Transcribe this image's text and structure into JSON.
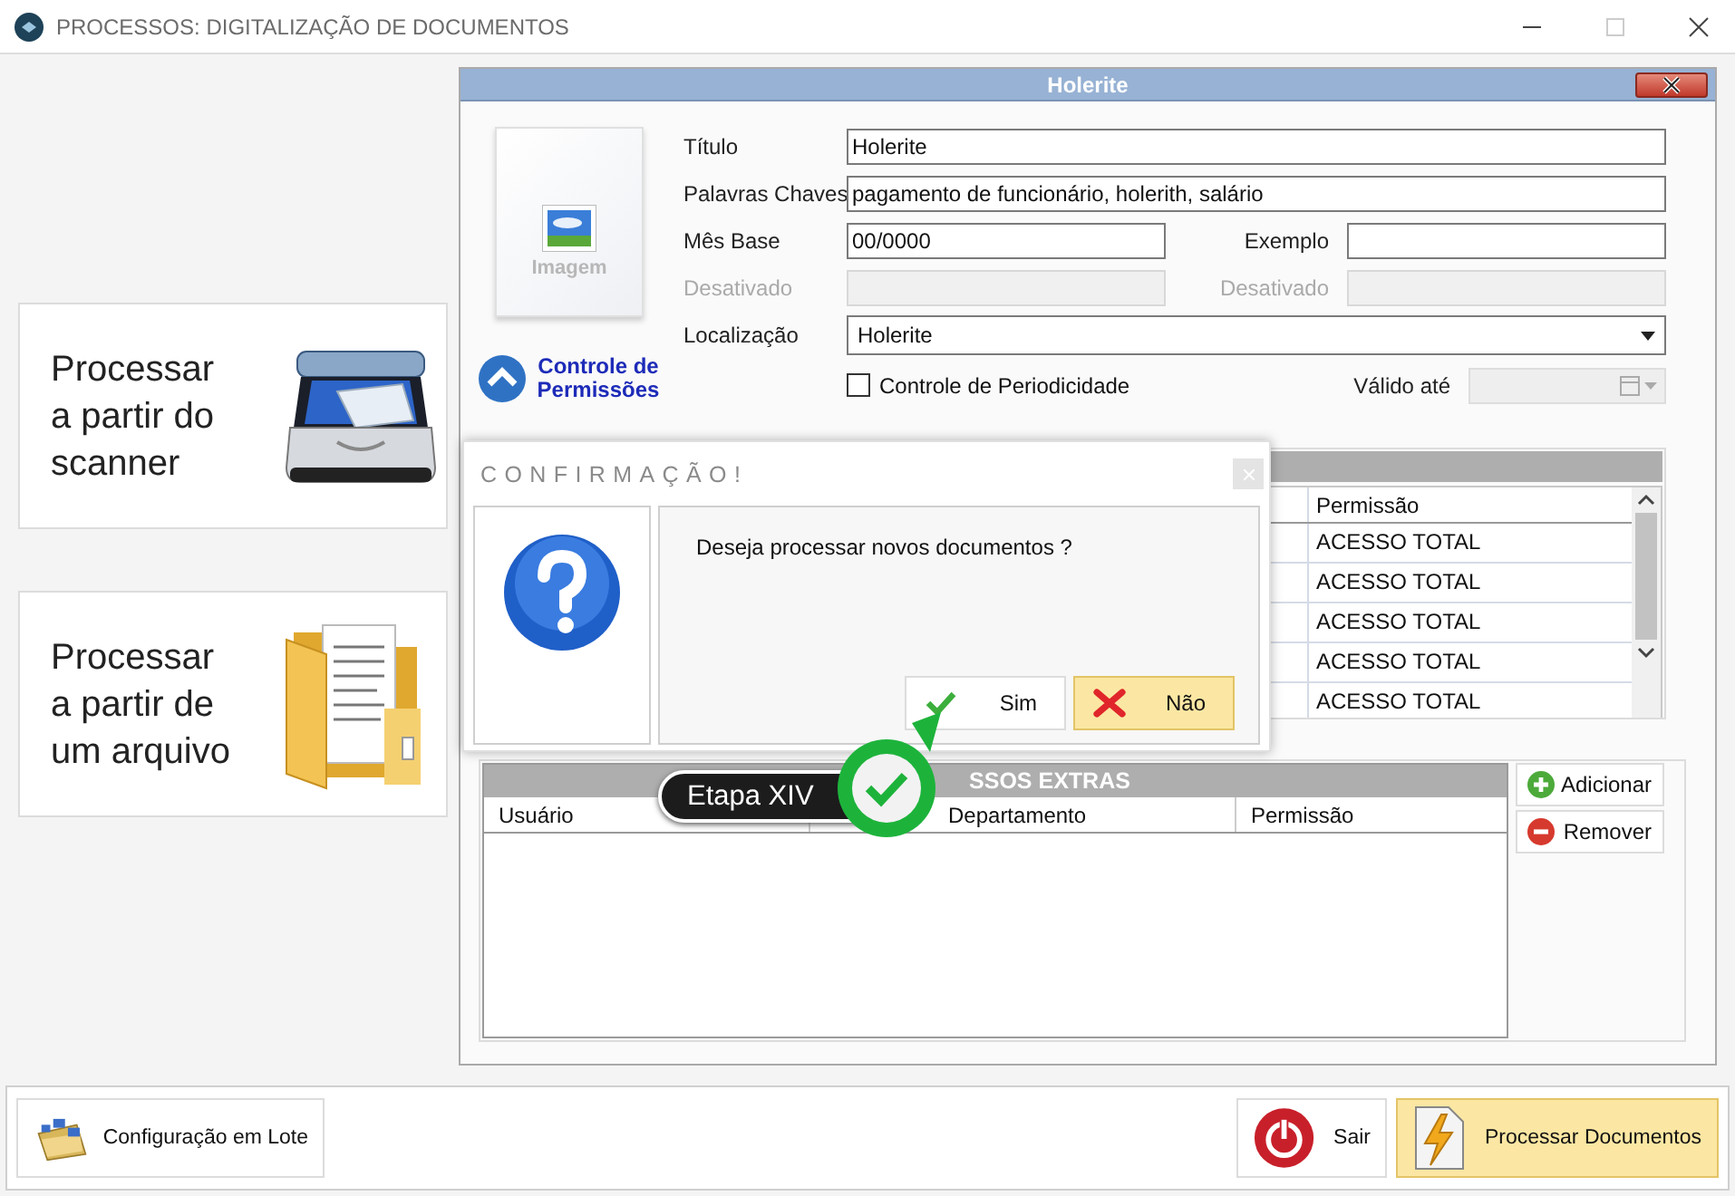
{
  "window": {
    "title": "PROCESSOS: DIGITALIZAÇÃO DE DOCUMENTOS"
  },
  "sources": [
    {
      "label": "Processar a partir do scanner",
      "kind": "scanner"
    },
    {
      "label": "Processar a partir de um arquivo",
      "kind": "folder"
    }
  ],
  "document_panel": {
    "title": "Holerite",
    "image_label": "Imagem",
    "permissions_link": "Controle de Permissões",
    "form_rows": [
      [
        {
          "label": "Título",
          "value": "Holerite",
          "kind": "text",
          "disabled": false
        }
      ],
      [
        {
          "label": "Palavras Chaves",
          "value": "pagamento de funcionário, holerith, salário",
          "kind": "text",
          "disabled": false
        }
      ],
      [
        {
          "label": "Mês Base",
          "value": "00/0000",
          "kind": "text",
          "disabled": false
        },
        {
          "label": "Exemplo",
          "kind": "text",
          "disabled": false
        }
      ],
      [
        {
          "label": "Desativado",
          "kind": "text",
          "disabled": true
        },
        {
          "label": "Desativado",
          "kind": "text",
          "disabled": true
        }
      ],
      [
        {
          "label": "Localização",
          "value": "Holerite",
          "kind": "dropdown",
          "disabled": false
        }
      ]
    ],
    "periodicity": {
      "label": "Controle de Periodicidade",
      "checked": false
    },
    "valid_until": {
      "label": "Válido até",
      "disabled": true
    }
  },
  "permissions_grid": {
    "columns": [
      "Permissão"
    ],
    "rows": [
      [
        "ACESSO TOTAL"
      ],
      [
        "ACESSO TOTAL"
      ],
      [
        "ACESSO TOTAL"
      ],
      [
        "ACESSO TOTAL"
      ],
      [
        "ACESSO TOTAL"
      ]
    ]
  },
  "extras_grid": {
    "title": "SSOS EXTRAS",
    "columns": [
      "Usuário",
      "Departamento",
      "Permissão"
    ],
    "buttons": [
      {
        "label": "Adicionar",
        "kind": "add"
      },
      {
        "label": "Remover",
        "kind": "remove"
      }
    ]
  },
  "dialog": {
    "title": "CONFIRMAÇÃO!",
    "message": "Deseja processar novos documentos ?",
    "buttons": [
      {
        "label": "Sim",
        "kind": "confirm",
        "selected": false
      },
      {
        "label": "Não",
        "kind": "cancel",
        "selected": true
      }
    ]
  },
  "step_badge": {
    "label": "Etapa XIV"
  },
  "footer": {
    "buttons": [
      {
        "label": "Configuração em Lote",
        "kind": "batch",
        "selected": false
      },
      {
        "label": "Sair",
        "kind": "exit",
        "selected": false
      },
      {
        "label": "Processar Documentos",
        "kind": "process",
        "selected": true
      }
    ]
  }
}
